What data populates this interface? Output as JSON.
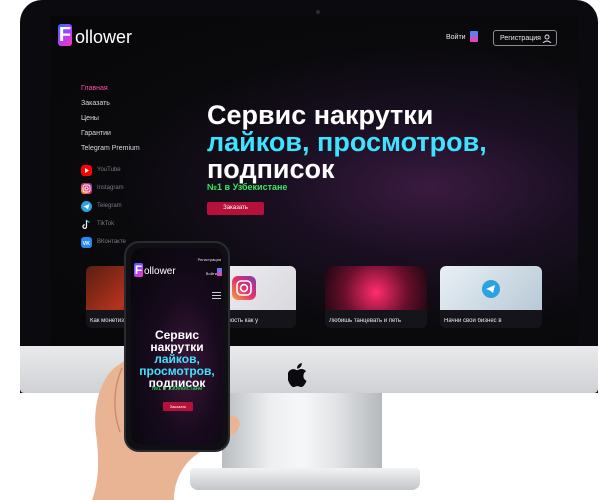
{
  "site": {
    "logo_letter": "F",
    "logo_rest": "ollower",
    "login_label": "Войти",
    "register_label": "Регистрация",
    "nav": [
      {
        "label": "Главная",
        "active": true
      },
      {
        "label": "Заказать"
      },
      {
        "label": "Цены"
      },
      {
        "label": "Гарантии"
      },
      {
        "label": "Telegram Premium"
      }
    ],
    "social": [
      {
        "label": "YouTube",
        "icon": "youtube-icon"
      },
      {
        "label": "Instagram",
        "icon": "instagram-icon"
      },
      {
        "label": "Telegram",
        "icon": "telegram-icon"
      },
      {
        "label": "TikTok",
        "icon": "tiktok-icon"
      },
      {
        "label": "ВКонтакте",
        "icon": "vk-icon"
      }
    ],
    "hero": {
      "line1": "Сервис накрутки",
      "line2": "лайков, просмотров,",
      "line3": "подписок",
      "subtitle": "№1 в Узбекистане",
      "order_label": "Заказать"
    },
    "cards": [
      {
        "caption": "Как монетизировать",
        "theme": "youtube"
      },
      {
        "caption": "Эффективность как у",
        "theme": "instagram"
      },
      {
        "caption": "Любишь танцевать и петь",
        "theme": "tiktok"
      },
      {
        "caption": "Начни свой бизнес в",
        "theme": "telegram"
      }
    ]
  },
  "phone": {
    "logo_letter": "F",
    "logo_rest": "ollower",
    "register_label": "Регистрация",
    "login_label": "Войти",
    "title_line1": "Сервис",
    "title_line2": "накрутки",
    "title_line3": "лайков,",
    "title_line4": "просмотров,",
    "title_line5": "подписок",
    "subtitle": "№1 в Узбекистане",
    "order_label": "Заказать"
  },
  "colors": {
    "accent_pink": "#ff4fa0",
    "accent_cyan": "#3fe3ff",
    "accent_green": "#38e85f",
    "button_red": "#b5113a"
  }
}
